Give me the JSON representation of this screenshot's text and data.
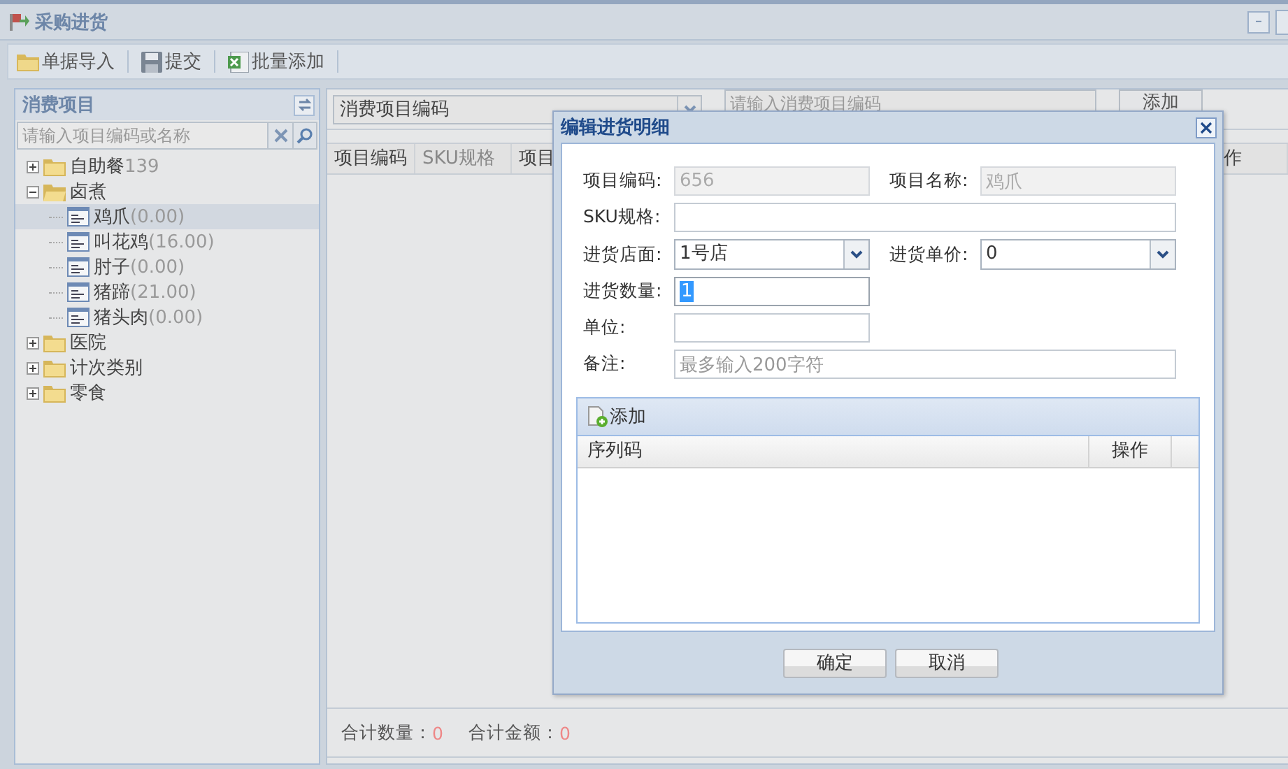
{
  "window": {
    "title": "采购进货",
    "controls": [
      "–"
    ]
  },
  "toolbar": [
    "单据导入",
    "提交",
    "批量添加"
  ],
  "sidebar": {
    "title": "消费项目",
    "search": {
      "placeholder": "请输入项目编码或名称"
    },
    "tree": [
      {
        "label": "自助餐",
        "count": "139",
        "expanded": false,
        "selected": false
      },
      {
        "label": "卤煮",
        "expanded": true,
        "selected": false,
        "children": [
          {
            "label": "鸡爪",
            "count": "(0.00)",
            "selected": true
          },
          {
            "label": "叫花鸡",
            "count": "(16.00)",
            "selected": false
          },
          {
            "label": "肘子",
            "count": "(0.00)",
            "selected": false
          },
          {
            "label": "猪蹄",
            "count": "(21.00)",
            "selected": false
          },
          {
            "label": "猪头肉",
            "count": "(0.00)",
            "selected": false
          }
        ]
      },
      {
        "label": "医院",
        "expanded": false,
        "selected": false
      },
      {
        "label": "计次类别",
        "expanded": false,
        "selected": false
      },
      {
        "label": "零食",
        "expanded": false,
        "selected": false
      }
    ]
  },
  "main": {
    "code_type": "消费项目编码",
    "search": {
      "placeholder": "请输入消费项目编码"
    },
    "add_button": "添加",
    "columns": [
      "项目编码",
      "SKU规格",
      "项目",
      "作"
    ],
    "footer": [
      {
        "label": "合计数量：",
        "value": "0"
      },
      {
        "label": "合计金额：",
        "value": "0"
      }
    ]
  },
  "dialog": {
    "title": "编辑进货明细",
    "rows": [
      [
        {
          "label": "项目编码:",
          "kind": "text",
          "value": "656",
          "disabled": true
        },
        {
          "label": "项目名称:",
          "kind": "text",
          "value": "鸡爪",
          "disabled": true
        }
      ],
      [
        {
          "label": "SKU规格:",
          "kind": "wide_text",
          "disabled": false
        }
      ],
      [
        {
          "label": "进货店面:",
          "kind": "combo",
          "value": "1号店",
          "disabled": false
        },
        {
          "label": "进货单价:",
          "kind": "combo",
          "value": "0",
          "disabled": false
        }
      ],
      [
        {
          "label": "进货数量:",
          "kind": "text",
          "value": "1",
          "disabled": false,
          "text_selected": true
        }
      ],
      [
        {
          "label": "单位:",
          "kind": "text",
          "disabled": false
        }
      ],
      [
        {
          "label": "备注:",
          "kind": "wide_text",
          "placeholder": "最多输入200字符",
          "disabled": false
        }
      ]
    ],
    "grid": {
      "add": "添加",
      "columns": [
        "序列码",
        "操作"
      ]
    },
    "buttons": [
      "确定",
      "取消"
    ]
  }
}
